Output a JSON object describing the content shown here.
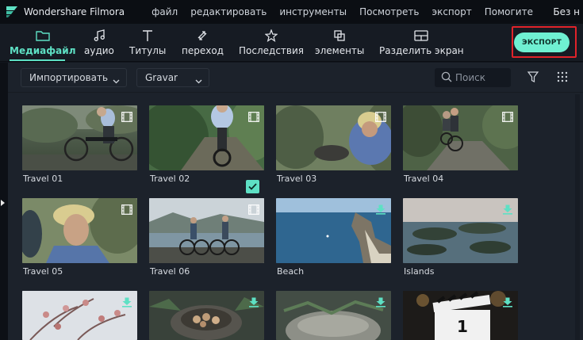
{
  "app": {
    "title": "Wondershare Filmora",
    "doc_title": "Без н"
  },
  "menu": [
    "файл",
    "редактировать",
    "инструменты",
    "Посмотреть",
    "экспорт",
    "Помогите"
  ],
  "toolbar": {
    "tabs": [
      {
        "label": "Медиафайл",
        "icon": "folder-icon",
        "active": true
      },
      {
        "label": "аудио",
        "icon": "music-note-icon"
      },
      {
        "label": "Титулы",
        "icon": "text-icon"
      },
      {
        "label": "переход",
        "icon": "transition-icon"
      },
      {
        "label": "Последствия",
        "icon": "effects-icon"
      },
      {
        "label": "элементы",
        "icon": "elements-icon"
      },
      {
        "label": "Разделить экран",
        "icon": "split-screen-icon"
      }
    ],
    "export_label": "ЭКСПОРТ"
  },
  "filters": {
    "import_label": "Импортировать",
    "category_label": "Gravar",
    "search_placeholder": "Поиск"
  },
  "media": [
    {
      "name": "Travel 01",
      "badge": "video-icon"
    },
    {
      "name": "Travel 02",
      "badge": "video-icon"
    },
    {
      "name": "Travel 03",
      "badge": "video-icon"
    },
    {
      "name": "Travel 04",
      "badge": "video-icon"
    },
    {
      "name": "Travel 05",
      "badge": "video-icon"
    },
    {
      "name": "Travel 06",
      "badge": "video-icon",
      "in_use": true
    },
    {
      "name": "Beach",
      "badge": "download-icon"
    },
    {
      "name": "Islands",
      "badge": "download-icon"
    },
    {
      "name": "",
      "badge": "download-icon"
    },
    {
      "name": "",
      "badge": "download-icon"
    },
    {
      "name": "",
      "badge": "download-icon"
    },
    {
      "name": "",
      "badge": "download-icon"
    }
  ],
  "colors": {
    "accent": "#5ee0c4",
    "export_bg": "#6ff0d2",
    "highlight": "#e0232a",
    "panel": "#1c222b"
  }
}
